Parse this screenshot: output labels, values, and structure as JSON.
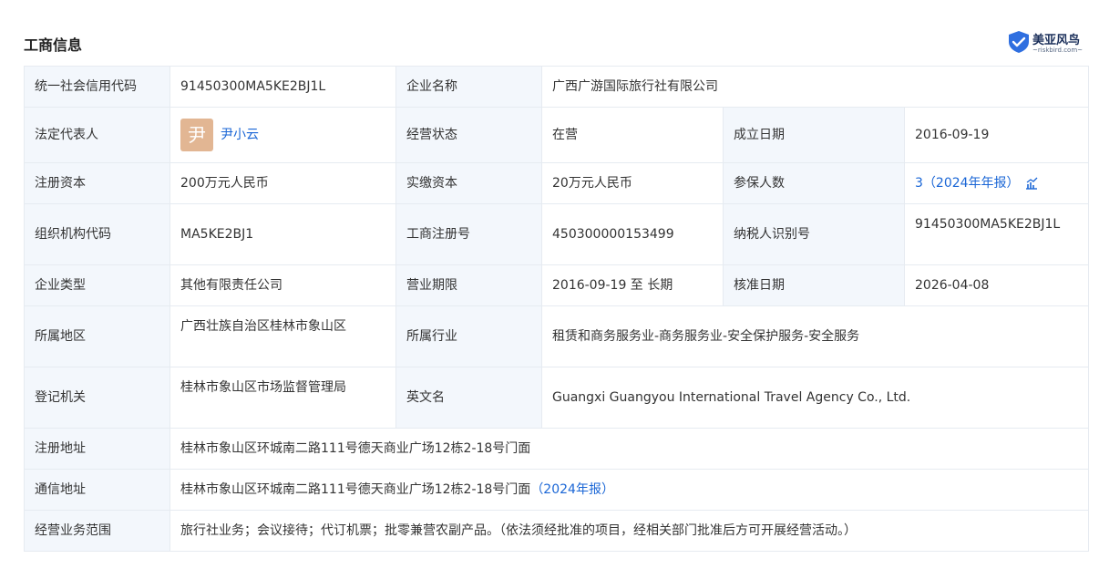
{
  "section_title": "工商信息",
  "logo": {
    "brand": "美亚风鸟",
    "domain": "riskbird.com",
    "accent": "#2f6fe0"
  },
  "colors": {
    "label_bg": "#f3f7fc",
    "border": "#e6ebf1",
    "link": "#1a66d6",
    "avatar_bg": "#e2b693"
  },
  "labels": {
    "credit_code": "统一社会信用代码",
    "company_name": "企业名称",
    "legal_rep": "法定代表人",
    "status": "经营状态",
    "founded": "成立日期",
    "reg_capital": "注册资本",
    "paid_capital": "实缴资本",
    "insured": "参保人数",
    "org_code": "组织机构代码",
    "biz_reg_no": "工商注册号",
    "tax_id": "纳税人识别号",
    "company_type": "企业类型",
    "biz_term": "营业期限",
    "approved_date": "核准日期",
    "region": "所属地区",
    "industry": "所属行业",
    "reg_authority": "登记机关",
    "english_name": "英文名",
    "reg_address": "注册地址",
    "mail_address": "通信地址",
    "biz_scope": "经营业务范围"
  },
  "values": {
    "credit_code": "91450300MA5KE2BJ1L",
    "company_name": "广西广游国际旅行社有限公司",
    "legal_rep_avatar": "尹",
    "legal_rep": "尹小云",
    "status": "在营",
    "founded": "2016-09-19",
    "reg_capital": "200万元人民币",
    "paid_capital": "20万元人民币",
    "insured": "3（2024年年报）",
    "org_code": "MA5KE2BJ1",
    "biz_reg_no": "450300000153499",
    "tax_id": "91450300MA5KE2BJ1L",
    "company_type": "其他有限责任公司",
    "biz_term": "2016-09-19 至 长期",
    "approved_date": "2026-04-08",
    "region": "广西壮族自治区桂林市象山区",
    "industry": "租赁和商务服务业-商务服务业-安全保护服务-安全服务",
    "reg_authority": "桂林市象山区市场监督管理局",
    "english_name": "Guangxi Guangyou International Travel Agency Co., Ltd.",
    "reg_address": "桂林市象山区环城南二路111号德天商业广场12栋2-18号门面",
    "mail_address": "桂林市象山区环城南二路111号德天商业广场12栋2-18号门面",
    "mail_address_tag": "（2024年报）",
    "biz_scope": "旅行社业务；会议接待；代订机票；批零兼营农副产品。（依法须经批准的项目，经相关部门批准后方可开展经营活动。）"
  }
}
